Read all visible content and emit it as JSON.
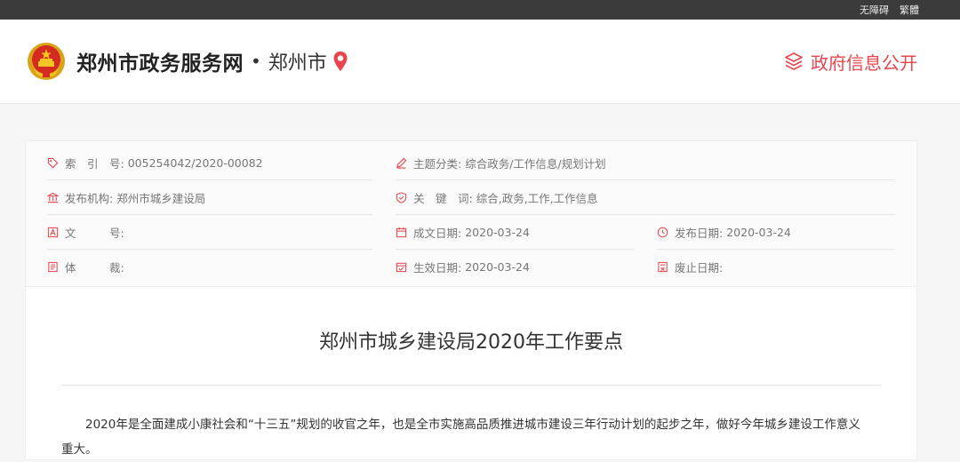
{
  "topbar": {
    "accessibility": "无障碍",
    "traditional": "繁體"
  },
  "header": {
    "site_name": "郑州市政务服务网",
    "separator": "•",
    "city": "郑州市",
    "open_info_label": "政府信息公开"
  },
  "meta": {
    "index_key": "索　引　号:",
    "index_val": "005254042/2020-00082",
    "topic_key": "主题分类:",
    "topic_val": "综合政务/工作信息/规划计划",
    "publisher_key": "发布机构:",
    "publisher_val": "郑州市城乡建设局",
    "keywords_key": "关　键　词:",
    "keywords_val": "综合,政务,工作,工作信息",
    "docno_key": "文　　　号:",
    "docno_val": "",
    "created_key": "成文日期:",
    "created_val": "2020-03-24",
    "published_key": "发布日期:",
    "published_val": "2020-03-24",
    "genre_key": "体　　　裁:",
    "genre_val": "",
    "effective_key": "生效日期:",
    "effective_val": "2020-03-24",
    "expire_key": "废止日期:",
    "expire_val": ""
  },
  "article": {
    "title": "郑州市城乡建设局2020年工作要点",
    "paragraph_1": "2020年是全面建成小康社会和“十三五”规划的收官之年，也是全市实施高品质推进城市建设三年行动计划的起步之年，做好今年城乡建设工作意义重大。"
  },
  "colors": {
    "accent": "#e8454e",
    "topbar": "#3b3b3b"
  }
}
